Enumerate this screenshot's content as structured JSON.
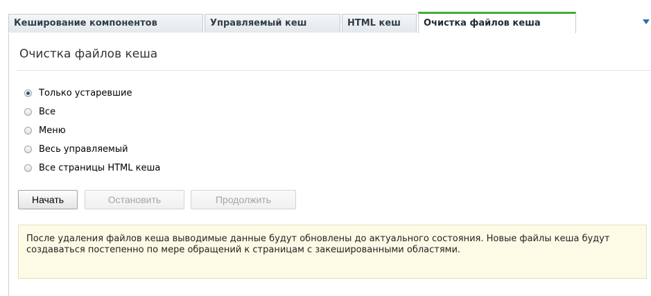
{
  "tabs": [
    {
      "label": "Кеширование компонентов"
    },
    {
      "label": "Управляемый кеш"
    },
    {
      "label": "HTML кеш"
    },
    {
      "label": "Очистка файлов кеша",
      "active": true
    }
  ],
  "panel": {
    "title": "Очистка файлов кеша",
    "options": [
      {
        "label": "Только устаревшие",
        "checked": true
      },
      {
        "label": "Все",
        "checked": false
      },
      {
        "label": "Меню",
        "checked": false
      },
      {
        "label": "Весь управляемый",
        "checked": false
      },
      {
        "label": "Все страницы HTML кеша",
        "checked": false
      }
    ],
    "buttons": {
      "start": "Начать",
      "stop": "Остановить",
      "continue": "Продолжить"
    },
    "note": "После удаления файлов кеша выводимые данные будут обновлены до актуального состояния. Новые файлы кеша будут создаваться постепенно по мере обращений к страницам с закешированными областями."
  },
  "colors": {
    "active_tab_accent": "#44ab3a",
    "note_background": "#fdfbe6",
    "dropdown_arrow": "#2d6bb8"
  }
}
